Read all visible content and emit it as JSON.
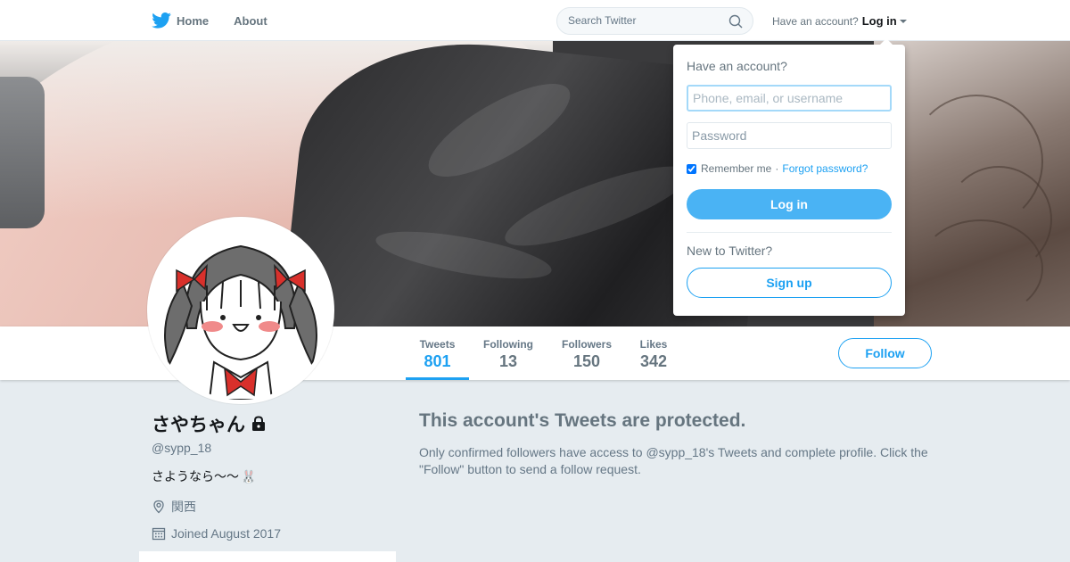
{
  "nav": {
    "home_label": "Home",
    "about_label": "About",
    "search_placeholder": "Search Twitter",
    "account_prompt": "Have an account?",
    "login_link": "Log in"
  },
  "profile": {
    "name": "さやちゃん",
    "handle": "@sypp_18",
    "bio": "さようなら～～",
    "bio_emoji": "🐰",
    "location": "関西",
    "joined": "Joined August 2017"
  },
  "stats": [
    {
      "label": "Tweets",
      "value": "801",
      "active": true
    },
    {
      "label": "Following",
      "value": "13",
      "active": false
    },
    {
      "label": "Followers",
      "value": "150",
      "active": false
    },
    {
      "label": "Likes",
      "value": "342",
      "active": false
    }
  ],
  "follow_label": "Follow",
  "protected": {
    "title": "This account's Tweets are protected.",
    "body": "Only confirmed followers have access to @sypp_18's Tweets and complete profile. Click the \"Follow\" button to send a follow request."
  },
  "login_dropdown": {
    "title": "Have an account?",
    "username_placeholder": "Phone, email, or username",
    "password_placeholder": "Password",
    "remember_label": "Remember me",
    "separator": "·",
    "forgot_label": "Forgot password?",
    "login_button": "Log in",
    "new_label": "New to Twitter?",
    "signup_button": "Sign up"
  },
  "colors": {
    "accent": "#1da1f2",
    "background": "#e6ecf0",
    "login_button": "#4ab3f4"
  },
  "icons": [
    "twitter-bird-icon",
    "search-icon",
    "chevron-down-icon",
    "lock-icon",
    "location-icon",
    "calendar-icon"
  ]
}
